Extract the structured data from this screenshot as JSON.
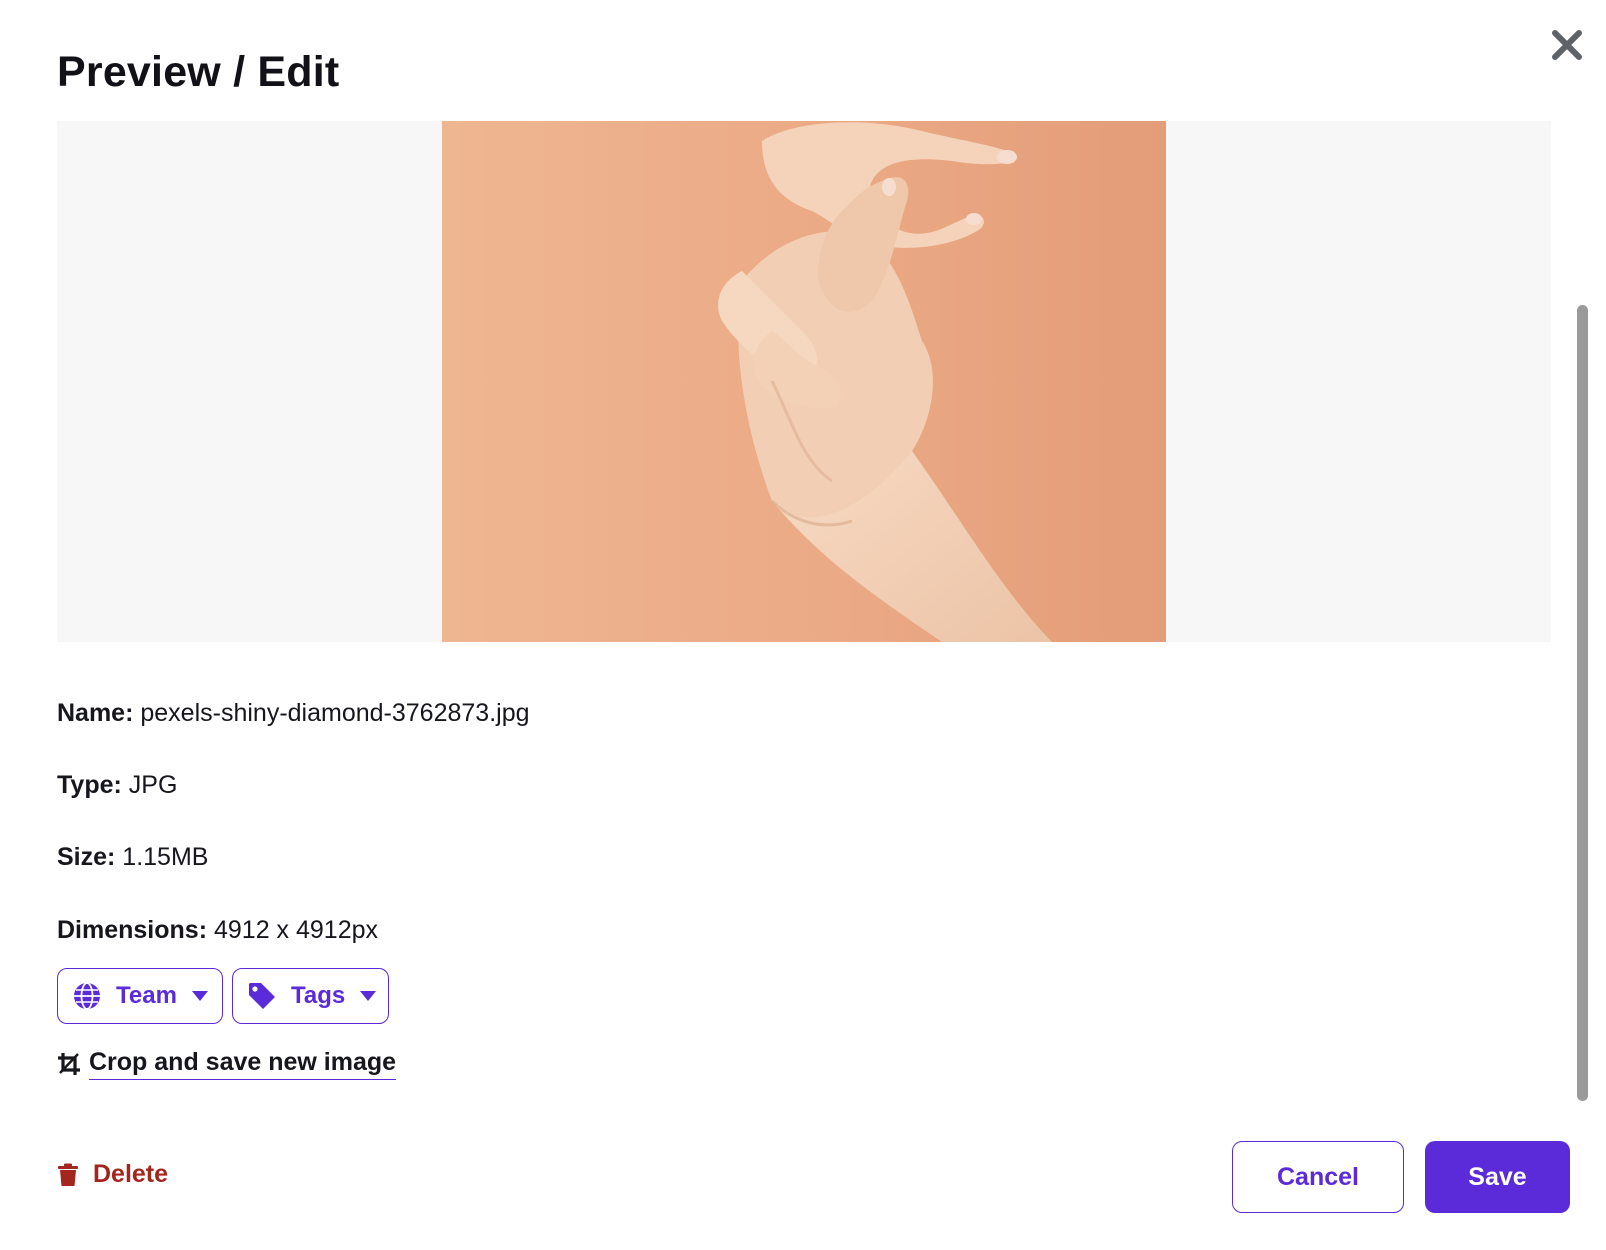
{
  "dialog": {
    "title": "Preview / Edit"
  },
  "preview": {
    "background_color": "#f7f7f7",
    "photo_background_color": "#e9a882",
    "photo_subject": "hands-on-peach-background"
  },
  "details": {
    "name_label": "Name:",
    "name_value": "pexels-shiny-diamond-3762873.jpg",
    "type_label": "Type:",
    "type_value": "JPG",
    "size_label": "Size:",
    "size_value": "1.15MB",
    "dimensions_label": "Dimensions:",
    "dimensions_value": "4912 x 4912px"
  },
  "chips": {
    "team_label": "Team",
    "team_icon": "globe-icon",
    "tags_label": "Tags",
    "tags_icon": "tag-icon"
  },
  "crop": {
    "label": "Crop and save new image",
    "icon": "crop-icon"
  },
  "footer": {
    "delete_label": "Delete",
    "delete_icon": "trash-icon",
    "cancel_label": "Cancel",
    "save_label": "Save"
  },
  "colors": {
    "accent": "#5b2bd9",
    "danger": "#a3261e",
    "text": "#16161d"
  }
}
